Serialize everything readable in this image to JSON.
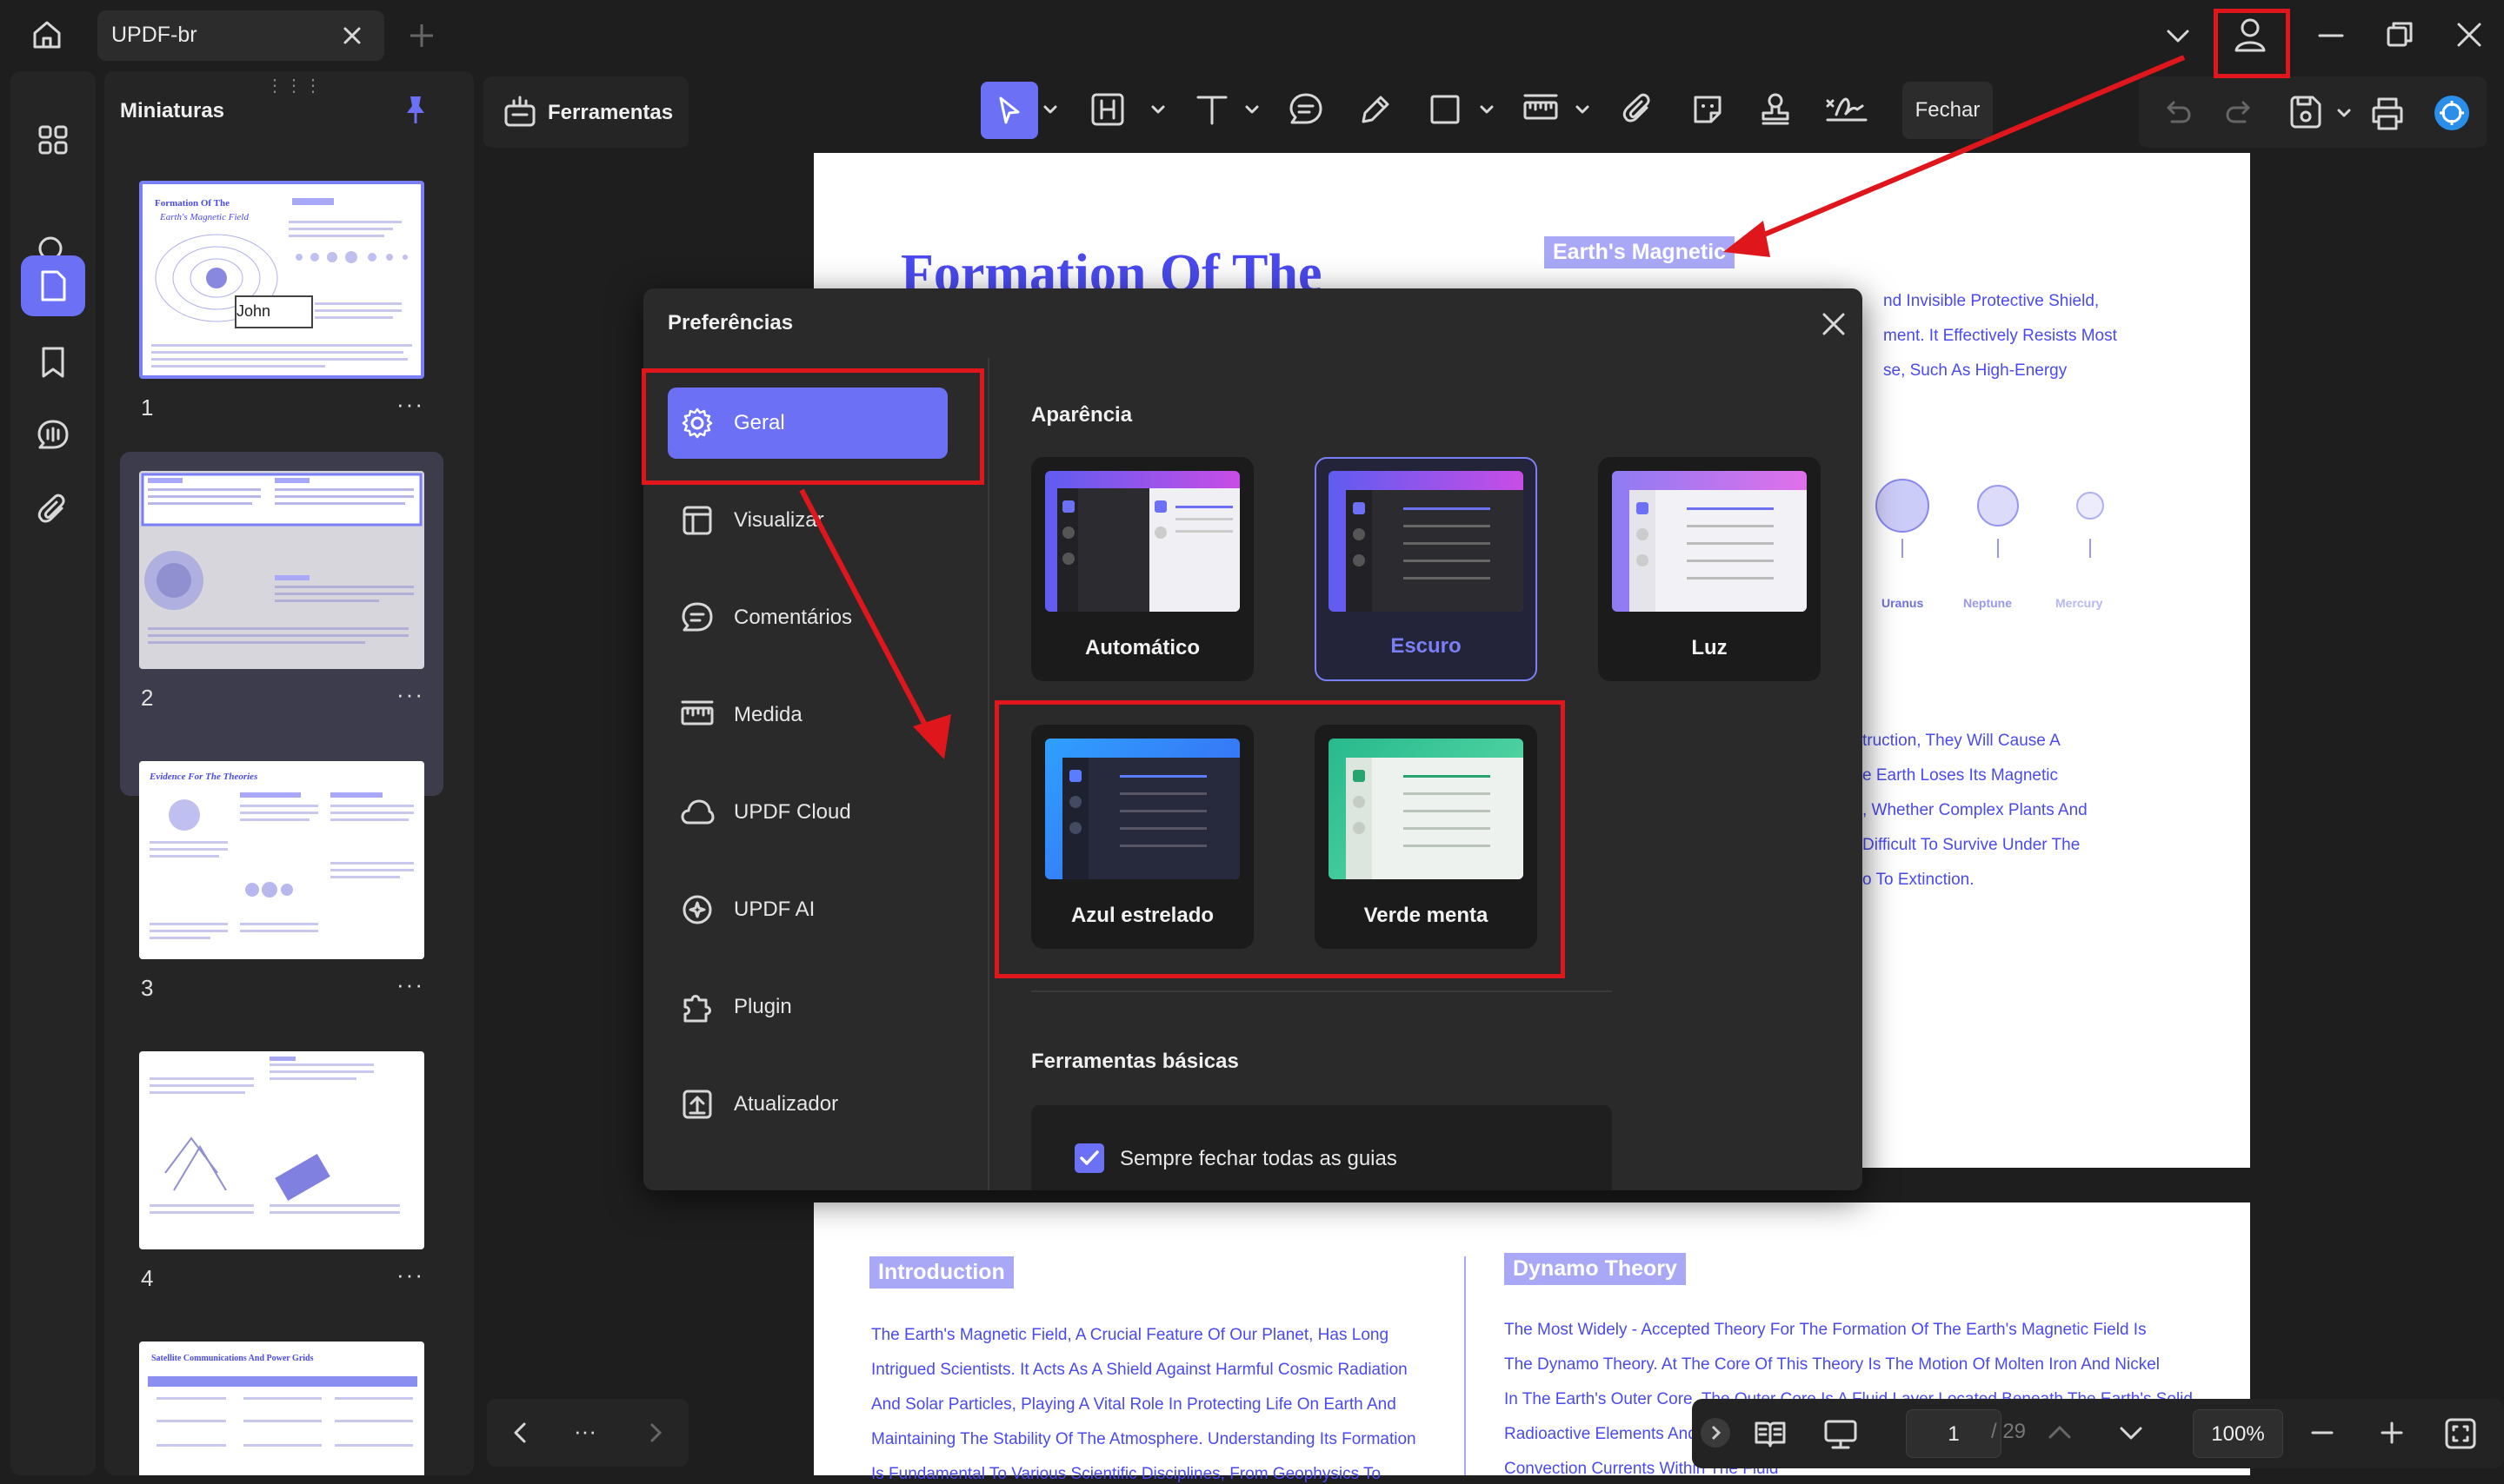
{
  "app": {
    "tab_title": "UPDF-br",
    "colors": {
      "accent": "#6b70f5",
      "annotation_red": "#e0161d",
      "dark_bg": "#1e1e1e",
      "panel_bg": "#252525"
    }
  },
  "thumbnails": {
    "title": "Miniaturas",
    "pages": [
      {
        "number": "1",
        "heading": "Formation Of The",
        "subheading": "Earth's Magnetic Field",
        "selected": true
      },
      {
        "number": "2",
        "selected": false
      },
      {
        "number": "3",
        "heading": "Evidence For The Theories",
        "selected": false
      },
      {
        "number": "4",
        "selected": false
      },
      {
        "number": "",
        "heading": "Satellite Communications And Power Grids",
        "selected": false
      }
    ],
    "thumb1_text": "John"
  },
  "toolbar": {
    "ferramentas_label": "Ferramentas",
    "fechar_label": "Fechar"
  },
  "document": {
    "page1": {
      "title": "Formation Of The",
      "tag": "Earth's Magnetic",
      "right_lines": [
        "nd Invisible Protective Shield,",
        "ment. It Effectively Resists Most",
        "se, Such As High-Energy"
      ],
      "planets": [
        "Uranus",
        "Neptune",
        "Mercury"
      ],
      "right_lines_2": [
        "truction, They Will Cause A",
        "e Earth Loses Its Magnetic",
        ", Whether Complex Plants And",
        "Difficult To Survive Under The",
        "o To Extinction."
      ]
    },
    "page2": {
      "intro_title": "Introduction",
      "intro_lines": [
        "The Earth's Magnetic Field, A Crucial Feature Of Our Planet, Has Long",
        "Intrigued Scientists. It Acts As A Shield Against Harmful Cosmic Radiation",
        "And Solar Particles, Playing A Vital Role In Protecting Life On Earth And",
        "Maintaining The Stability Of The Atmosphere. Understanding Its Formation",
        "Is Fundamental To Various Scientific Disciplines, From Geophysics To"
      ],
      "dynamo_title": "Dynamo Theory",
      "dynamo_lines": [
        "The Most Widely - Accepted Theory For The Formation Of The Earth's Magnetic Field Is",
        "The Dynamo Theory. At The Core Of This Theory Is The Motion Of Molten Iron And Nickel",
        "In The Earth's Outer Core. The Outer Core Is A Fluid Layer Located Beneath The Earth's Solid",
        "Radioactive Elements And",
        "Convection Currents Within The Fluid"
      ]
    }
  },
  "dialog": {
    "title": "Preferências",
    "nav": [
      {
        "label": "Geral",
        "icon": "gear-icon",
        "active": true
      },
      {
        "label": "Visualizar",
        "icon": "layout-icon",
        "active": false
      },
      {
        "label": "Comentários",
        "icon": "comment-icon",
        "active": false
      },
      {
        "label": "Medida",
        "icon": "ruler-icon",
        "active": false
      },
      {
        "label": "UPDF Cloud",
        "icon": "cloud-icon",
        "active": false
      },
      {
        "label": "UPDF AI",
        "icon": "ai-icon",
        "active": false
      },
      {
        "label": "Plugin",
        "icon": "puzzle-icon",
        "active": false
      },
      {
        "label": "Atualizador",
        "icon": "update-icon",
        "active": false
      }
    ],
    "appearance_title": "Aparência",
    "themes": [
      {
        "label": "Automático",
        "selected": false
      },
      {
        "label": "Escuro",
        "selected": true
      },
      {
        "label": "Luz",
        "selected": false
      },
      {
        "label": "Azul estrelado",
        "selected": false
      },
      {
        "label": "Verde menta",
        "selected": false
      }
    ],
    "basic_tools_title": "Ferramentas básicas",
    "checkbox_label": "Sempre fechar todas as guias",
    "checkbox_checked": true
  },
  "bottom_bar": {
    "current_page": "1",
    "total_pages": "/ 29",
    "zoom": "100%"
  }
}
